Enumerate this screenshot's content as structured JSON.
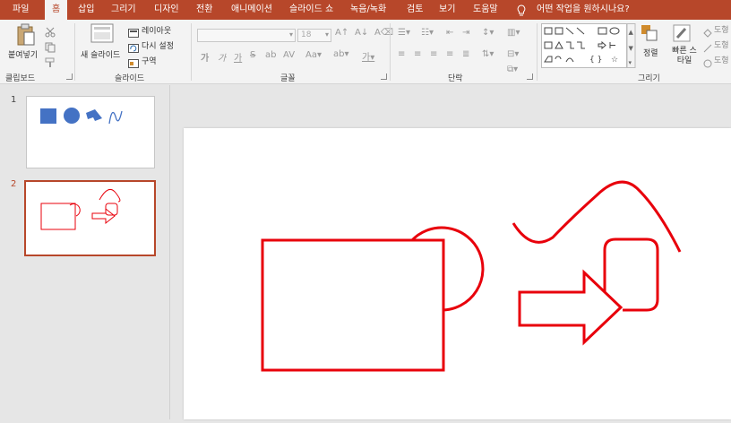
{
  "tabs": [
    "파일",
    "홈",
    "삽입",
    "그리기",
    "디자인",
    "전환",
    "애니메이션",
    "슬라이드 쇼",
    "녹음/녹화",
    "검토",
    "보기",
    "도움말"
  ],
  "active_tab": "홈",
  "help_search": "어떤 작업을 원하시나요?",
  "ribbon": {
    "clipboard": {
      "paste": "붙여넣기",
      "label": "클립보드"
    },
    "slides": {
      "new_slide": "새 슬라이드",
      "layout": "레이아웃",
      "reset": "다시 설정",
      "section": "구역",
      "label": "슬라이드"
    },
    "font": {
      "size": "18",
      "label": "글꼴"
    },
    "paragraph": {
      "label": "단락"
    },
    "drawing": {
      "arrange": "정렬",
      "quick_styles": "빠른 스타일",
      "shape1": "도형",
      "shape2": "도형",
      "shape3": "도형",
      "label": "그리기"
    }
  },
  "thumbnails": [
    {
      "number": "1"
    },
    {
      "number": "2"
    }
  ],
  "colors": {
    "accent": "#b7472a",
    "shape_blue": "#4472c4",
    "shape_red": "#e8000b"
  }
}
